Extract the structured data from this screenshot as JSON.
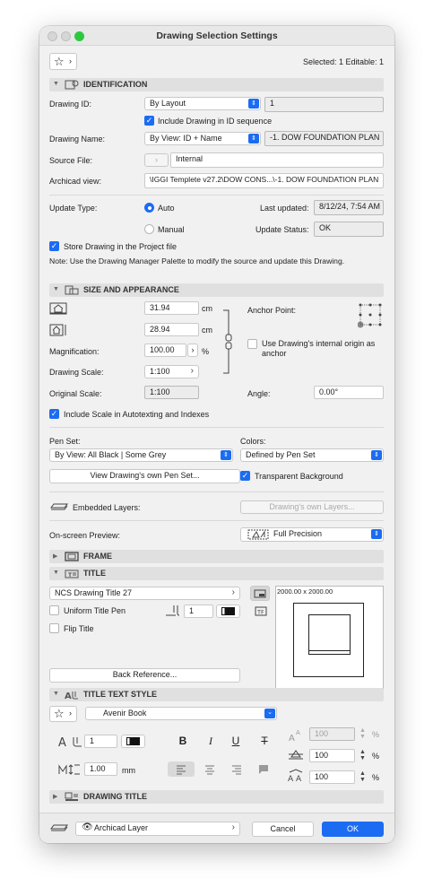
{
  "window": {
    "title": "Drawing Selection Settings"
  },
  "top": {
    "selected": "Selected: 1 Editable: 1"
  },
  "identification": {
    "header": "IDENTIFICATION",
    "drawing_id_label": "Drawing ID:",
    "drawing_id_mode": "By Layout",
    "drawing_id_value": "1",
    "include_in_id_label": "Include Drawing in ID sequence",
    "drawing_name_label": "Drawing Name:",
    "drawing_name_mode": "By View: ID + Name",
    "drawing_name_value": "-1. DOW FOUNDATION PLAN",
    "source_file_label": "Source File:",
    "source_file_value": "Internal",
    "archicad_view_label": "Archicad view:",
    "archicad_view_value": "\\IGGI Templete v27.2\\DOW CONS...\\-1. DOW FOUNDATION PLAN",
    "update_type_label": "Update Type:",
    "update_auto": "Auto",
    "update_manual": "Manual",
    "last_updated_label": "Last updated:",
    "last_updated_value": "8/12/24, 7:54 AM",
    "update_status_label": "Update Status:",
    "update_status_value": "OK",
    "store_label": "Store Drawing in the Project file",
    "note": "Note: Use the Drawing Manager Palette to modify the source and update this Drawing."
  },
  "size": {
    "header": "SIZE AND APPEARANCE",
    "width_value": "31.94",
    "height_value": "28.94",
    "unit": "cm",
    "magnification_label": "Magnification:",
    "magnification_value": "100.00",
    "percent": "%",
    "drawing_scale_label": "Drawing Scale:",
    "drawing_scale_value": "1:100",
    "original_scale_label": "Original Scale:",
    "original_scale_value": "1:100",
    "anchor_label": "Anchor Point:",
    "internal_origin_label": "Use Drawing's internal origin as anchor",
    "angle_label": "Angle:",
    "angle_value": "0.00°",
    "include_scale_label": "Include Scale in Autotexting and Indexes",
    "pen_set_label": "Pen Set:",
    "pen_set_value": "By View: All Black | Some Grey",
    "colors_label": "Colors:",
    "colors_value": "Defined by Pen Set",
    "view_pen_set_button": "View Drawing's own Pen Set...",
    "transparent_label": "Transparent Background",
    "embedded_layers_label": "Embedded Layers:",
    "own_layers_button": "Drawing's own Layers...",
    "preview_label": "On-screen Preview:",
    "preview_value": "Full Precision"
  },
  "frame": {
    "header": "FRAME"
  },
  "title": {
    "header": "TITLE",
    "type_value": "NCS Drawing Title 27",
    "uniform_pen_label": "Uniform Title Pen",
    "pen_value": "1",
    "flip_label": "Flip Title",
    "preview_size": "2000.00 x 2000.00",
    "back_reference_button": "Back Reference..."
  },
  "title_text": {
    "header": "TITLE TEXT STYLE",
    "font_value": "Avenir Book",
    "pen_value": "1",
    "size_value": "1.00",
    "size_unit": "mm",
    "width_value": "100",
    "spacing_value": "100",
    "slant_value": "100",
    "percent": "%"
  },
  "drawing_title": {
    "header": "DRAWING TITLE"
  },
  "footer": {
    "layer_value": "Archicad Layer",
    "cancel": "Cancel",
    "ok": "OK"
  },
  "colors": {
    "accent": "#1b6cf2",
    "section_bg": "#e0e0e0",
    "window_bg": "#f1f1f1"
  }
}
